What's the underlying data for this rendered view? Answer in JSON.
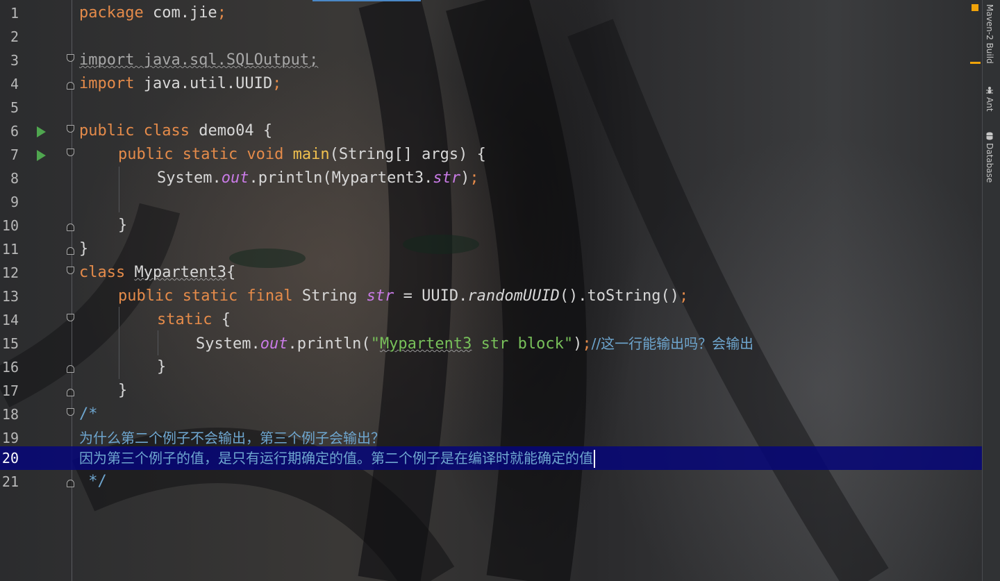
{
  "editor": {
    "current_line": 20,
    "lines": [
      {
        "n": "1"
      },
      {
        "n": "2"
      },
      {
        "n": "3"
      },
      {
        "n": "4"
      },
      {
        "n": "5"
      },
      {
        "n": "6"
      },
      {
        "n": "7"
      },
      {
        "n": "8"
      },
      {
        "n": "9"
      },
      {
        "n": "10"
      },
      {
        "n": "11"
      },
      {
        "n": "12"
      },
      {
        "n": "13"
      },
      {
        "n": "14"
      },
      {
        "n": "15"
      },
      {
        "n": "16"
      },
      {
        "n": "17"
      },
      {
        "n": "18"
      },
      {
        "n": "19"
      },
      {
        "n": "20"
      },
      {
        "n": "21"
      }
    ],
    "code": {
      "l1_kw": "package",
      "l1_rest": " com.jie",
      "l1_semi": ";",
      "l3_text": "import java.sql.SQLOutput;",
      "l4_kw": "import",
      "l4_rest": " java.util.UUID",
      "l4_semi": ";",
      "l6_kw": "public class",
      "l6_rest": " demo04 {",
      "l7_kw": "public static void",
      "l7_fn": "main",
      "l7_rest": "(String[] args) {",
      "l8_a": "System.",
      "l8_out": "out",
      "l8_b": ".println(Mypartent3.",
      "l8_str": "str",
      "l8_c": ")",
      "l8_semi": ";",
      "l10_text": "}",
      "l11_text": "}",
      "l12_kw": "class",
      "l12_sp": " ",
      "l12_name": "Mypartent3",
      "l12_rest": "{",
      "l13_kw": "public static final",
      "l13_a": " String ",
      "l13_str": "str",
      "l13_b": " = UUID.",
      "l13_fn": "randomUUID",
      "l13_c": "().toString()",
      "l13_semi": ";",
      "l14_kw": "static",
      "l14_rest": " {",
      "l15_a": "System.",
      "l15_out": "out",
      "l15_b": ".println(",
      "l15_q1": "\"",
      "l15_w": "Mypartent3",
      "l15_s": " str block\"",
      "l15_c": ")",
      "l15_semi": ";",
      "l15_cmt": "//这一行能输出吗？会输出",
      "l16_text": "}",
      "l17_text": "}",
      "l18_text": "/*",
      "l19_text": "为什么第二个例子不会输出，第三个例子会输出？",
      "l20_text": "因为第三个例子的值，是只有运行期确定的值。第二个例子是在编译时就能确定的值",
      "l21_text": " */"
    }
  },
  "tool_windows": [
    {
      "label": "Maven-2 Build",
      "icon": "maven-icon"
    },
    {
      "label": "Ant",
      "icon": "ant-icon"
    },
    {
      "label": "Database",
      "icon": "database-icon"
    }
  ],
  "colors": {
    "keyword": "#e58b4a",
    "method": "#f0c04e",
    "field": "#c97be6",
    "string": "#78c05a",
    "comment": "#6ea6cf",
    "current_line": "#06067a",
    "warning_marker": "#f0a30a",
    "run_icon": "#4fa64f"
  }
}
